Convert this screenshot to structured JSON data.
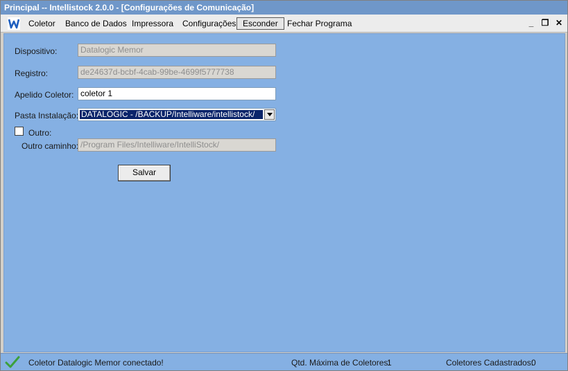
{
  "window": {
    "title": "Principal -- Intellistock 2.0.0 - [Configurações de Comunicação]"
  },
  "menu": {
    "items": [
      "Coletor",
      "Banco de Dados",
      "Impressora",
      "Configurações",
      "Esconder",
      "Fechar Programa"
    ],
    "active": "Esconder",
    "minimize_glyph": "_",
    "restore_glyph": "❐",
    "close_glyph": "✕"
  },
  "form": {
    "dispositivo_label": "Dispositivo:",
    "dispositivo_value": "Datalogic Memor",
    "registro_label": "Registro:",
    "registro_value": "de24637d-bcbf-4cab-99be-4699f5777738",
    "apelido_label": "Apelido Coletor:",
    "apelido_value": "coletor 1",
    "pasta_label": "Pasta Instalação:",
    "pasta_value": "DATALOGIC - /BACKUP/Intelliware/intellistock/",
    "outro_label": "Outro:",
    "outro_checked": false,
    "outro_caminho_label": "Outro caminho:",
    "outro_caminho_value": "/Program Files/Intelliware/IntelliStock/",
    "salvar_label": "Salvar"
  },
  "status": {
    "message": "Coletor Datalogic Memor conectado!",
    "max_label": "Qtd. Máxima de Coletores:",
    "max_value": "1",
    "cadastrados_label": "Coletores Cadastrados:",
    "cadastrados_value": "0"
  },
  "colors": {
    "title_bar": "#6f97c9",
    "client_area": "#85b0e3",
    "combo_highlight": "#0a246a",
    "success_check": "#3ca03c"
  }
}
